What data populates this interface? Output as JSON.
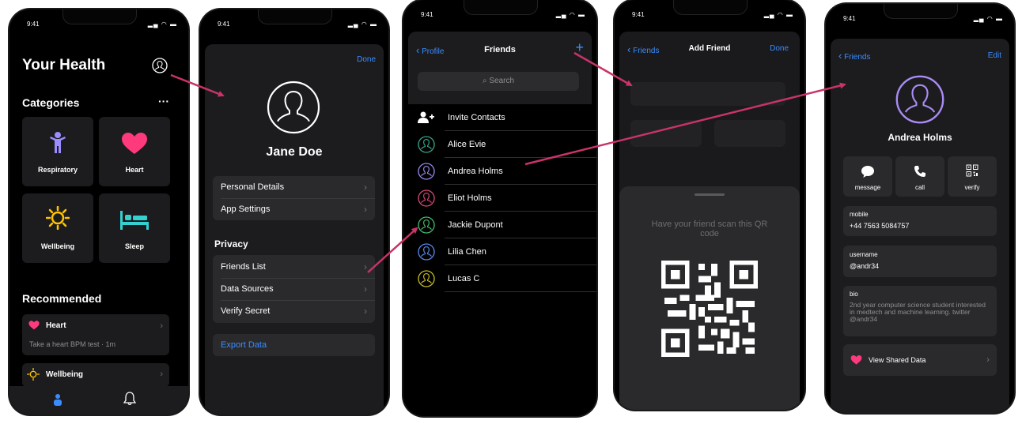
{
  "status": {
    "time": "9:41"
  },
  "screen1": {
    "title": "Your Health",
    "categories_heading": "Categories",
    "more": "···",
    "tiles": [
      {
        "label": "Respiratory",
        "icon": "person-icon",
        "color": "#9b8cff"
      },
      {
        "label": "Heart",
        "icon": "heart-icon",
        "color": "#ff3a7c"
      },
      {
        "label": "Wellbeing",
        "icon": "sun-icon",
        "color": "#ffc400"
      },
      {
        "label": "Sleep",
        "icon": "bed-icon",
        "color": "#35d0d0"
      }
    ],
    "recommended_heading": "Recommended",
    "rec_heart": {
      "title": "Heart",
      "subtitle": "Take a heart BPM test · 1m"
    },
    "rec_wellbeing": {
      "title": "Wellbeing"
    }
  },
  "screen2": {
    "done": "Done",
    "name": "Jane Doe",
    "group1": [
      "Personal Details",
      "App Settings"
    ],
    "privacy_heading": "Privacy",
    "group2": [
      "Friends List",
      "Data Sources",
      "Verify Secret"
    ],
    "export": "Export Data"
  },
  "screen3": {
    "back": "Profile",
    "title": "Friends",
    "add": "+",
    "search_placeholder": "Search",
    "invite": "Invite Contacts",
    "friends": [
      {
        "name": "Alice Evie",
        "color": "#3aa88e"
      },
      {
        "name": "Andrea Holms",
        "color": "#9a8cf0"
      },
      {
        "name": "Eliot Holms",
        "color": "#e04878"
      },
      {
        "name": "Jackie Dupont",
        "color": "#46c070"
      },
      {
        "name": "Lilia Chen",
        "color": "#5a8cf0"
      },
      {
        "name": "Lucas C",
        "color": "#c8c020"
      }
    ]
  },
  "screen4": {
    "back": "Friends",
    "title": "Add Friend",
    "done": "Done",
    "scan_text": "Have your friend scan this QR code"
  },
  "screen5": {
    "back": "Friends",
    "edit": "Edit",
    "name": "Andrea Holms",
    "actions": [
      {
        "label": "message",
        "icon": "message-icon"
      },
      {
        "label": "call",
        "icon": "phone-icon"
      },
      {
        "label": "verify",
        "icon": "qr-icon"
      }
    ],
    "mobile_label": "mobile",
    "mobile_value": "+44 7563 5084757",
    "username_label": "username",
    "username_value": "@andr34",
    "bio_label": "bio",
    "bio_value": "2nd year computer science student interested in medtech and machine learning. twitter @andr34",
    "shared": "View Shared Data"
  },
  "colors": {
    "accent": "#3a8cff",
    "arrow": "#c8336a",
    "avatar_purple": "#a98cf5"
  }
}
